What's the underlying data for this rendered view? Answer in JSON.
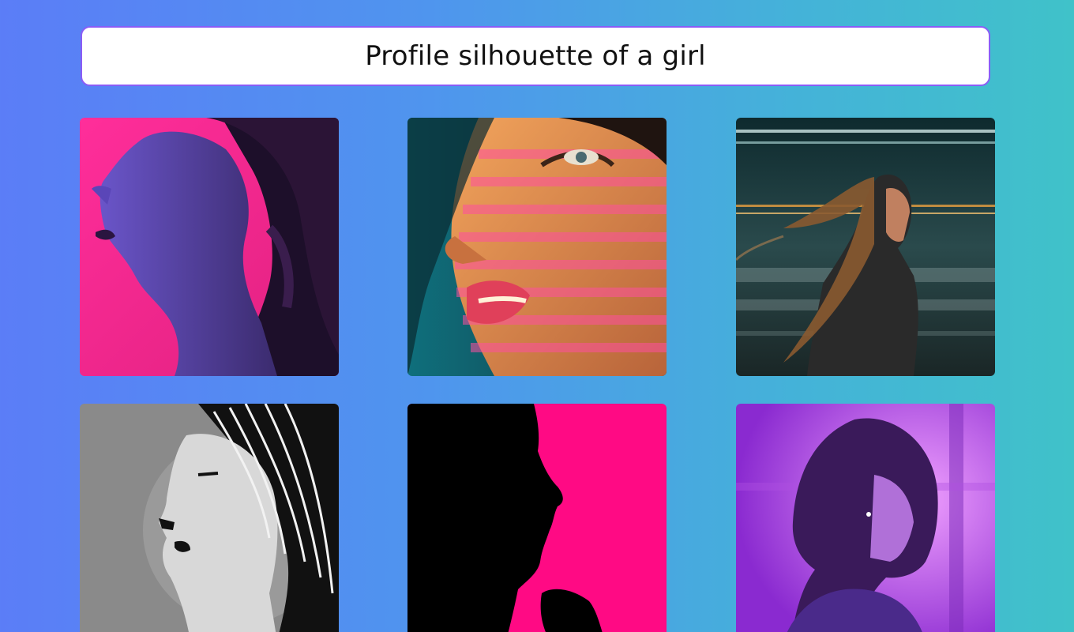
{
  "prompt": {
    "text": "Profile silhouette of a girl"
  },
  "colors": {
    "background_left": "#5b7df7",
    "background_right": "#40c2c9",
    "prompt_border": "#8b5cf6",
    "neon_pink": "#ff2e9a",
    "hot_pink": "#ff0a84",
    "purple": "#a040e0"
  },
  "images": [
    {
      "name": "neon-profile-portrait"
    },
    {
      "name": "closeup-striped-light-portrait"
    },
    {
      "name": "motion-blur-city-portrait"
    },
    {
      "name": "monochrome-illustration-portrait"
    },
    {
      "name": "black-silhouette-on-pink"
    },
    {
      "name": "purple-glow-portrait"
    }
  ]
}
